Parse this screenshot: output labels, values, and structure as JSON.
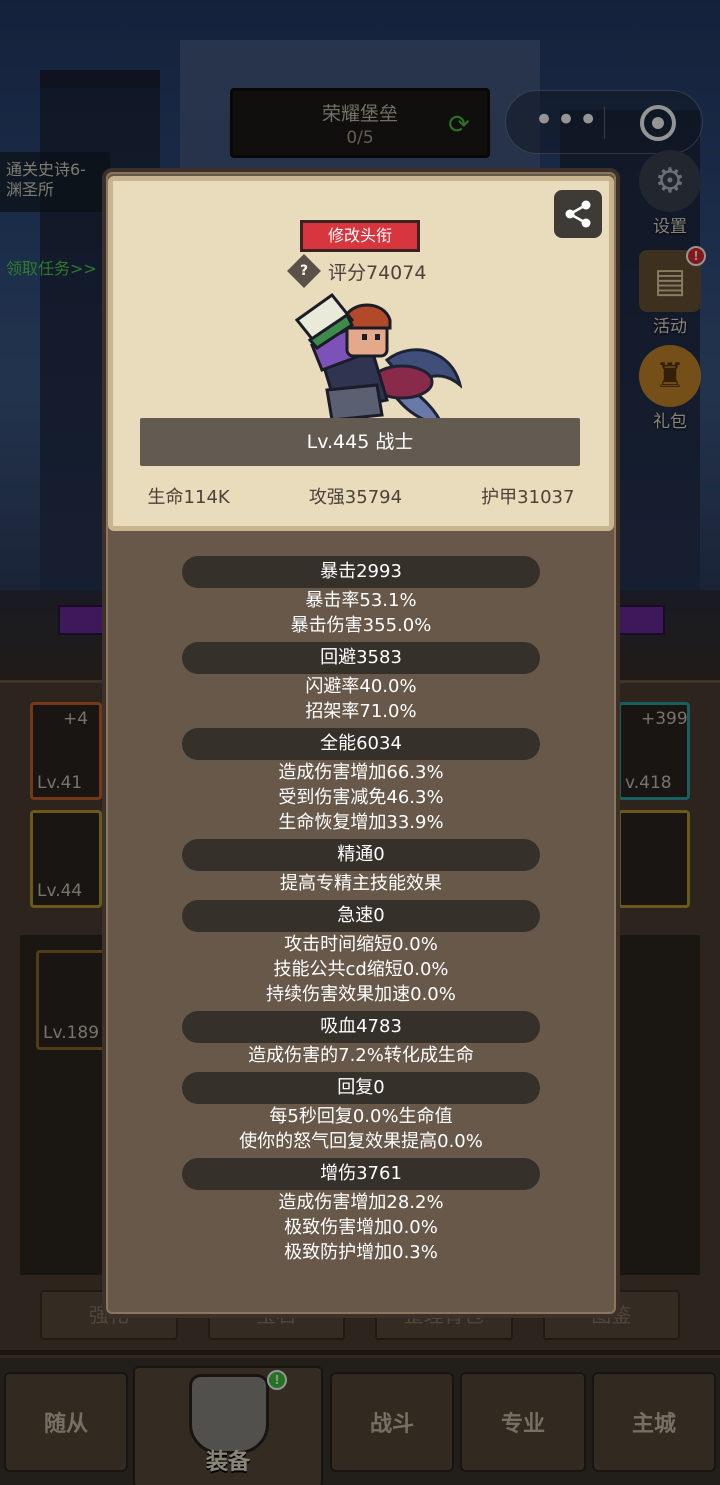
{
  "top_banner": {
    "title": "荣耀堡垒",
    "progress": "0/5"
  },
  "quest": {
    "line1": "通关史诗6-",
    "line2": "渊圣所",
    "link": "领取任务>>"
  },
  "side_icons": [
    {
      "label": "设置"
    },
    {
      "label": "活动",
      "badge": "!"
    },
    {
      "label": "礼包"
    }
  ],
  "background_slots": {
    "slot1_top": "+4",
    "slot1_lv": "Lv.41",
    "slot2_lv": "Lv.44",
    "slot3_lv": "Lv.189",
    "slot4_top": "+399",
    "slot4_lv": "v.418"
  },
  "subtabs": [
    "强化",
    "宝石",
    "整理背包",
    "图鉴"
  ],
  "navbar": {
    "items": [
      "随从",
      "装备",
      "战斗",
      "专业",
      "主城"
    ],
    "badge": "!"
  },
  "profile": {
    "title_button": "修改头衔",
    "score": "评分74074",
    "level_class": "Lv.445 战士",
    "hp": "生命114K",
    "attack": "攻强35794",
    "armor": "护甲31037"
  },
  "attributes": [
    {
      "head": "暴击2993",
      "lines": [
        "暴击率53.1%",
        "暴击伤害355.0%"
      ]
    },
    {
      "head": "回避3583",
      "lines": [
        "闪避率40.0%",
        "招架率71.0%"
      ]
    },
    {
      "head": "全能6034",
      "lines": [
        "造成伤害增加66.3%",
        "受到伤害减免46.3%",
        "生命恢复增加33.9%"
      ]
    },
    {
      "head": "精通0",
      "lines": [
        "提高专精主技能效果"
      ]
    },
    {
      "head": "急速0",
      "lines": [
        "攻击时间缩短0.0%",
        "技能公共cd缩短0.0%",
        "持续伤害效果加速0.0%"
      ]
    },
    {
      "head": "吸血4783",
      "lines": [
        "造成伤害的7.2%转化成生命"
      ]
    },
    {
      "head": "回复0",
      "lines": [
        "每5秒回复0.0%生命值",
        "使你的怒气回复效果提高0.0%"
      ]
    },
    {
      "head": "增伤3761",
      "lines": [
        "造成伤害增加28.2%",
        "极致伤害增加0.0%",
        "极致防护增加0.3%"
      ]
    }
  ]
}
